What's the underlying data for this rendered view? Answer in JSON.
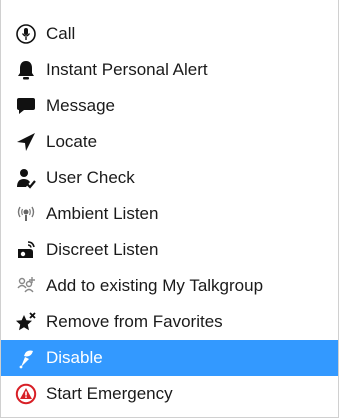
{
  "colors": {
    "selected_bg": "#3399ff",
    "text": "#1a1a1a",
    "emergency": "#d81f26"
  },
  "menu": {
    "items": [
      {
        "label": "Call",
        "icon": "call-icon"
      },
      {
        "label": "Instant Personal Alert",
        "icon": "bell-icon"
      },
      {
        "label": "Message",
        "icon": "message-icon"
      },
      {
        "label": "Locate",
        "icon": "locate-arrow-icon"
      },
      {
        "label": "User Check",
        "icon": "user-check-icon"
      },
      {
        "label": "Ambient Listen",
        "icon": "ambient-listen-icon"
      },
      {
        "label": "Discreet Listen",
        "icon": "discreet-listen-icon"
      },
      {
        "label": "Add to existing My Talkgroup",
        "icon": "add-talkgroup-icon"
      },
      {
        "label": "Remove from Favorites",
        "icon": "remove-favorite-star-icon"
      },
      {
        "label": "Disable",
        "icon": "disable-icon",
        "selected": true
      },
      {
        "label": "Start Emergency",
        "icon": "emergency-icon"
      }
    ]
  }
}
